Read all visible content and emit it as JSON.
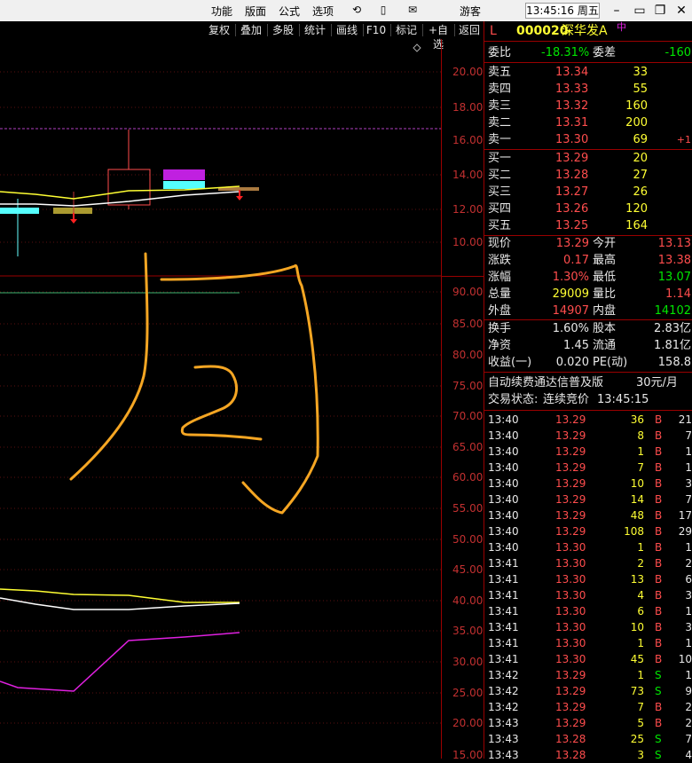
{
  "menu": {
    "items": [
      "功能",
      "版面",
      "公式",
      "选项"
    ],
    "guest": "游客",
    "clock": "13:45:16 周五"
  },
  "toolbar": [
    "复权",
    "叠加",
    "多股",
    "统计",
    "画线",
    "F10",
    "标记",
    "+自选",
    "返回"
  ],
  "axis": {
    "price_ticks": [
      "20.00",
      "18.00",
      "16.00",
      "14.00",
      "12.00",
      "10.00"
    ],
    "indicator_ticks": [
      "90.00",
      "85.00",
      "80.00",
      "75.00",
      "70.00",
      "65.00",
      "60.00",
      "55.00",
      "50.00",
      "45.00",
      "40.00",
      "35.00",
      "30.00",
      "25.00",
      "20.00",
      "15.00"
    ]
  },
  "stock": {
    "flag": "L",
    "code": "000020",
    "name": "深华发A",
    "tag": "中"
  },
  "order": {
    "ratio_label": "委比",
    "ratio": "-18.31%",
    "diff_label": "委差",
    "diff": "-160"
  },
  "asks": [
    {
      "label": "卖五",
      "price": "13.34",
      "vol": "33",
      "chg": ""
    },
    {
      "label": "卖四",
      "price": "13.33",
      "vol": "55",
      "chg": ""
    },
    {
      "label": "卖三",
      "price": "13.32",
      "vol": "160",
      "chg": ""
    },
    {
      "label": "卖二",
      "price": "13.31",
      "vol": "200",
      "chg": ""
    },
    {
      "label": "卖一",
      "price": "13.30",
      "vol": "69",
      "chg": "+1"
    }
  ],
  "bids": [
    {
      "label": "买一",
      "price": "13.29",
      "vol": "20"
    },
    {
      "label": "买二",
      "price": "13.28",
      "vol": "27"
    },
    {
      "label": "买三",
      "price": "13.27",
      "vol": "26"
    },
    {
      "label": "买四",
      "price": "13.26",
      "vol": "120"
    },
    {
      "label": "买五",
      "price": "13.25",
      "vol": "164"
    }
  ],
  "quote": [
    {
      "l1": "现价",
      "v1": "13.29",
      "c1": "red",
      "l2": "今开",
      "v2": "13.13",
      "c2": "red"
    },
    {
      "l1": "涨跌",
      "v1": "0.17",
      "c1": "red",
      "l2": "最高",
      "v2": "13.38",
      "c2": "red"
    },
    {
      "l1": "涨幅",
      "v1": "1.30%",
      "c1": "red",
      "l2": "最低",
      "v2": "13.07",
      "c2": "green"
    },
    {
      "l1": "总量",
      "v1": "29009",
      "c1": "yellow",
      "l2": "量比",
      "v2": "1.14",
      "c2": "red"
    },
    {
      "l1": "外盘",
      "v1": "14907",
      "c1": "red",
      "l2": "内盘",
      "v2": "14102",
      "c2": "green"
    }
  ],
  "fin": [
    {
      "l1": "换手",
      "v1": "1.60%",
      "l2": "股本",
      "v2": "2.83亿"
    },
    {
      "l1": "净资",
      "v1": "1.45",
      "l2": "流通",
      "v2": "1.81亿"
    },
    {
      "l1": "收益(一)",
      "v1": "0.020",
      "l2": "PE(动)",
      "v2": "158.8"
    }
  ],
  "promo": {
    "text": "自动续费通达信普及版",
    "price": "30元/月"
  },
  "trade_status": {
    "label": "交易状态:",
    "value": "连续竞价",
    "time": "13:45:15"
  },
  "ticks": [
    {
      "t": "13:40",
      "p": "13.29",
      "v": "36",
      "s": "B",
      "n": "21"
    },
    {
      "t": "13:40",
      "p": "13.29",
      "v": "8",
      "s": "B",
      "n": "7"
    },
    {
      "t": "13:40",
      "p": "13.29",
      "v": "1",
      "s": "B",
      "n": "1"
    },
    {
      "t": "13:40",
      "p": "13.29",
      "v": "7",
      "s": "B",
      "n": "1"
    },
    {
      "t": "13:40",
      "p": "13.29",
      "v": "10",
      "s": "B",
      "n": "3"
    },
    {
      "t": "13:40",
      "p": "13.29",
      "v": "14",
      "s": "B",
      "n": "7"
    },
    {
      "t": "13:40",
      "p": "13.29",
      "v": "48",
      "s": "B",
      "n": "17"
    },
    {
      "t": "13:40",
      "p": "13.29",
      "v": "108",
      "s": "B",
      "n": "29"
    },
    {
      "t": "13:40",
      "p": "13.30",
      "v": "1",
      "s": "B",
      "n": "1"
    },
    {
      "t": "13:41",
      "p": "13.30",
      "v": "2",
      "s": "B",
      "n": "2"
    },
    {
      "t": "13:41",
      "p": "13.30",
      "v": "13",
      "s": "B",
      "n": "6"
    },
    {
      "t": "13:41",
      "p": "13.30",
      "v": "4",
      "s": "B",
      "n": "3"
    },
    {
      "t": "13:41",
      "p": "13.30",
      "v": "6",
      "s": "B",
      "n": "1"
    },
    {
      "t": "13:41",
      "p": "13.30",
      "v": "10",
      "s": "B",
      "n": "3"
    },
    {
      "t": "13:41",
      "p": "13.30",
      "v": "1",
      "s": "B",
      "n": "1"
    },
    {
      "t": "13:41",
      "p": "13.30",
      "v": "45",
      "s": "B",
      "n": "10"
    },
    {
      "t": "13:42",
      "p": "13.29",
      "v": "1",
      "s": "S",
      "n": "1"
    },
    {
      "t": "13:42",
      "p": "13.29",
      "v": "73",
      "s": "S",
      "n": "9"
    },
    {
      "t": "13:42",
      "p": "13.29",
      "v": "7",
      "s": "B",
      "n": "2"
    },
    {
      "t": "13:43",
      "p": "13.29",
      "v": "5",
      "s": "B",
      "n": "2"
    },
    {
      "t": "13:43",
      "p": "13.28",
      "v": "25",
      "s": "S",
      "n": "7"
    },
    {
      "t": "13:43",
      "p": "13.28",
      "v": "3",
      "s": "S",
      "n": "4"
    }
  ],
  "colors": {
    "up": "#ff4d4d",
    "down": "#00e600",
    "accent": "#ffff33",
    "border": "#9a0000",
    "annotation": "#f5a623"
  }
}
